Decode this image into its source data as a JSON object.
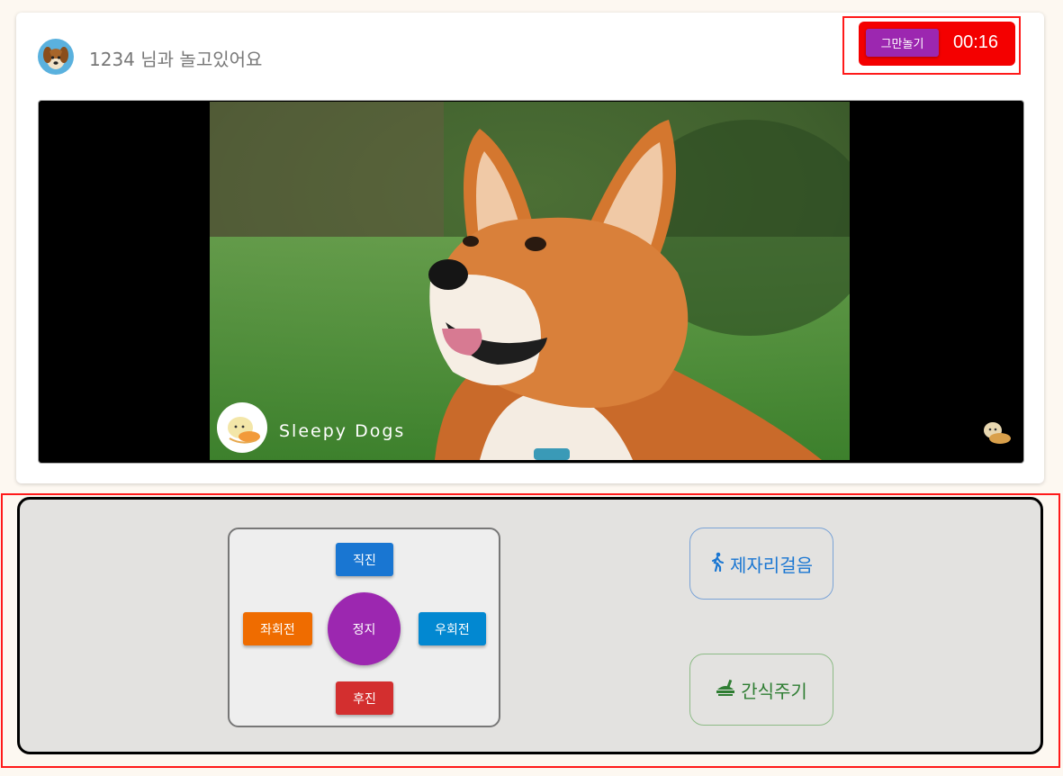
{
  "session": {
    "title": "1234 님과 놀고있어요",
    "avatar_icon": "dog-avatar-icon"
  },
  "timer": {
    "stop_label": "그만놀기",
    "elapsed": "00:16",
    "colors": {
      "box": "#f40000",
      "button": "#9c27b0"
    }
  },
  "video": {
    "channel_name": "Sleepy Dogs",
    "channel_logo_icon": "sleepy-dogs-logo",
    "watermark_icon": "dog-watermark-icon"
  },
  "controls": {
    "forward": "직진",
    "left": "좌회전",
    "stop": "정지",
    "right": "우회전",
    "back": "후진",
    "colors": {
      "forward": "#1976d2",
      "left": "#ef6c00",
      "stop": "#9c27b0",
      "right": "#0288d1",
      "back": "#d32f2f"
    }
  },
  "actions": {
    "walk_label": "제자리걸음",
    "walk_icon": "walking-person-icon",
    "treat_label": "간식주기",
    "treat_icon": "food-bowl-icon"
  }
}
